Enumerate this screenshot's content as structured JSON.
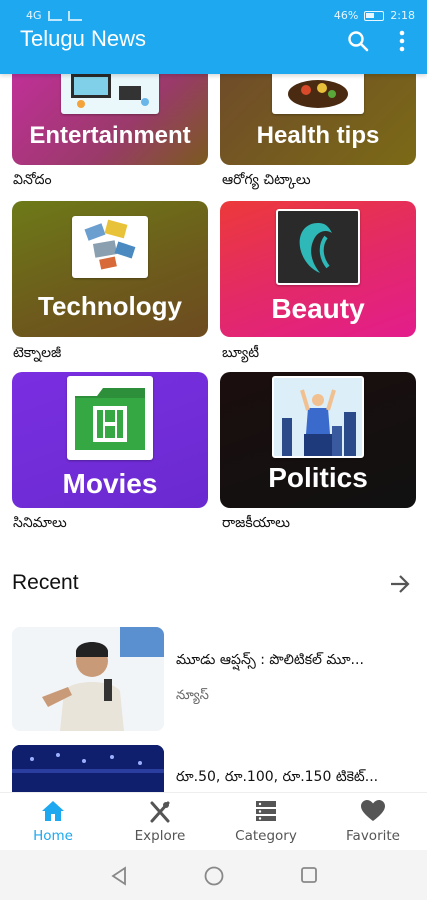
{
  "status_bar": {
    "left": "4G",
    "battery": "46%",
    "time": "2:18"
  },
  "app_bar": {
    "title": "Telugu News"
  },
  "categories": [
    {
      "label": "Entertainment",
      "caption": "వినోదం",
      "gradient": [
        "#c22f9a",
        "#7a5b1e"
      ]
    },
    {
      "label": "Health tips",
      "caption": "ఆరోగ్య చిట్కాలు",
      "gradient": [
        "#6f4b2a",
        "#7b6a16"
      ]
    },
    {
      "label": "Technology",
      "caption": "టెక్నాలజీ",
      "gradient": [
        "#6d7a18",
        "#6d4b20"
      ]
    },
    {
      "label": "Beauty",
      "caption": "బ్యూటీ",
      "gradient": [
        "#ec3a3a",
        "#e31d8c"
      ]
    },
    {
      "label": "Movies",
      "caption": "సినిమాలు",
      "gradient": [
        "#7a2fe0",
        "#6a2ad0"
      ]
    },
    {
      "label": "Politics",
      "caption": "రాజకీయాలు",
      "gradient": [
        "#1b0e0e",
        "#111111"
      ]
    }
  ],
  "recent": {
    "title": "Recent",
    "items": [
      {
        "title": "మూడు ఆప్షన్స్ : పొలిటికల్ మూ...",
        "source": "న్యూస్"
      },
      {
        "title": "రూ.50, రూ.100, రూ.150 టికెట్...",
        "source": ""
      }
    ]
  },
  "bottom_nav": [
    {
      "label": "Home",
      "icon": "home-icon",
      "active": true
    },
    {
      "label": "Explore",
      "icon": "fork-knife-icon",
      "active": false
    },
    {
      "label": "Category",
      "icon": "category-icon",
      "active": false
    },
    {
      "label": "Favorite",
      "icon": "heart-icon",
      "active": false
    }
  ],
  "colors": {
    "accent": "#1ea8f0",
    "inactive": "#555555"
  }
}
